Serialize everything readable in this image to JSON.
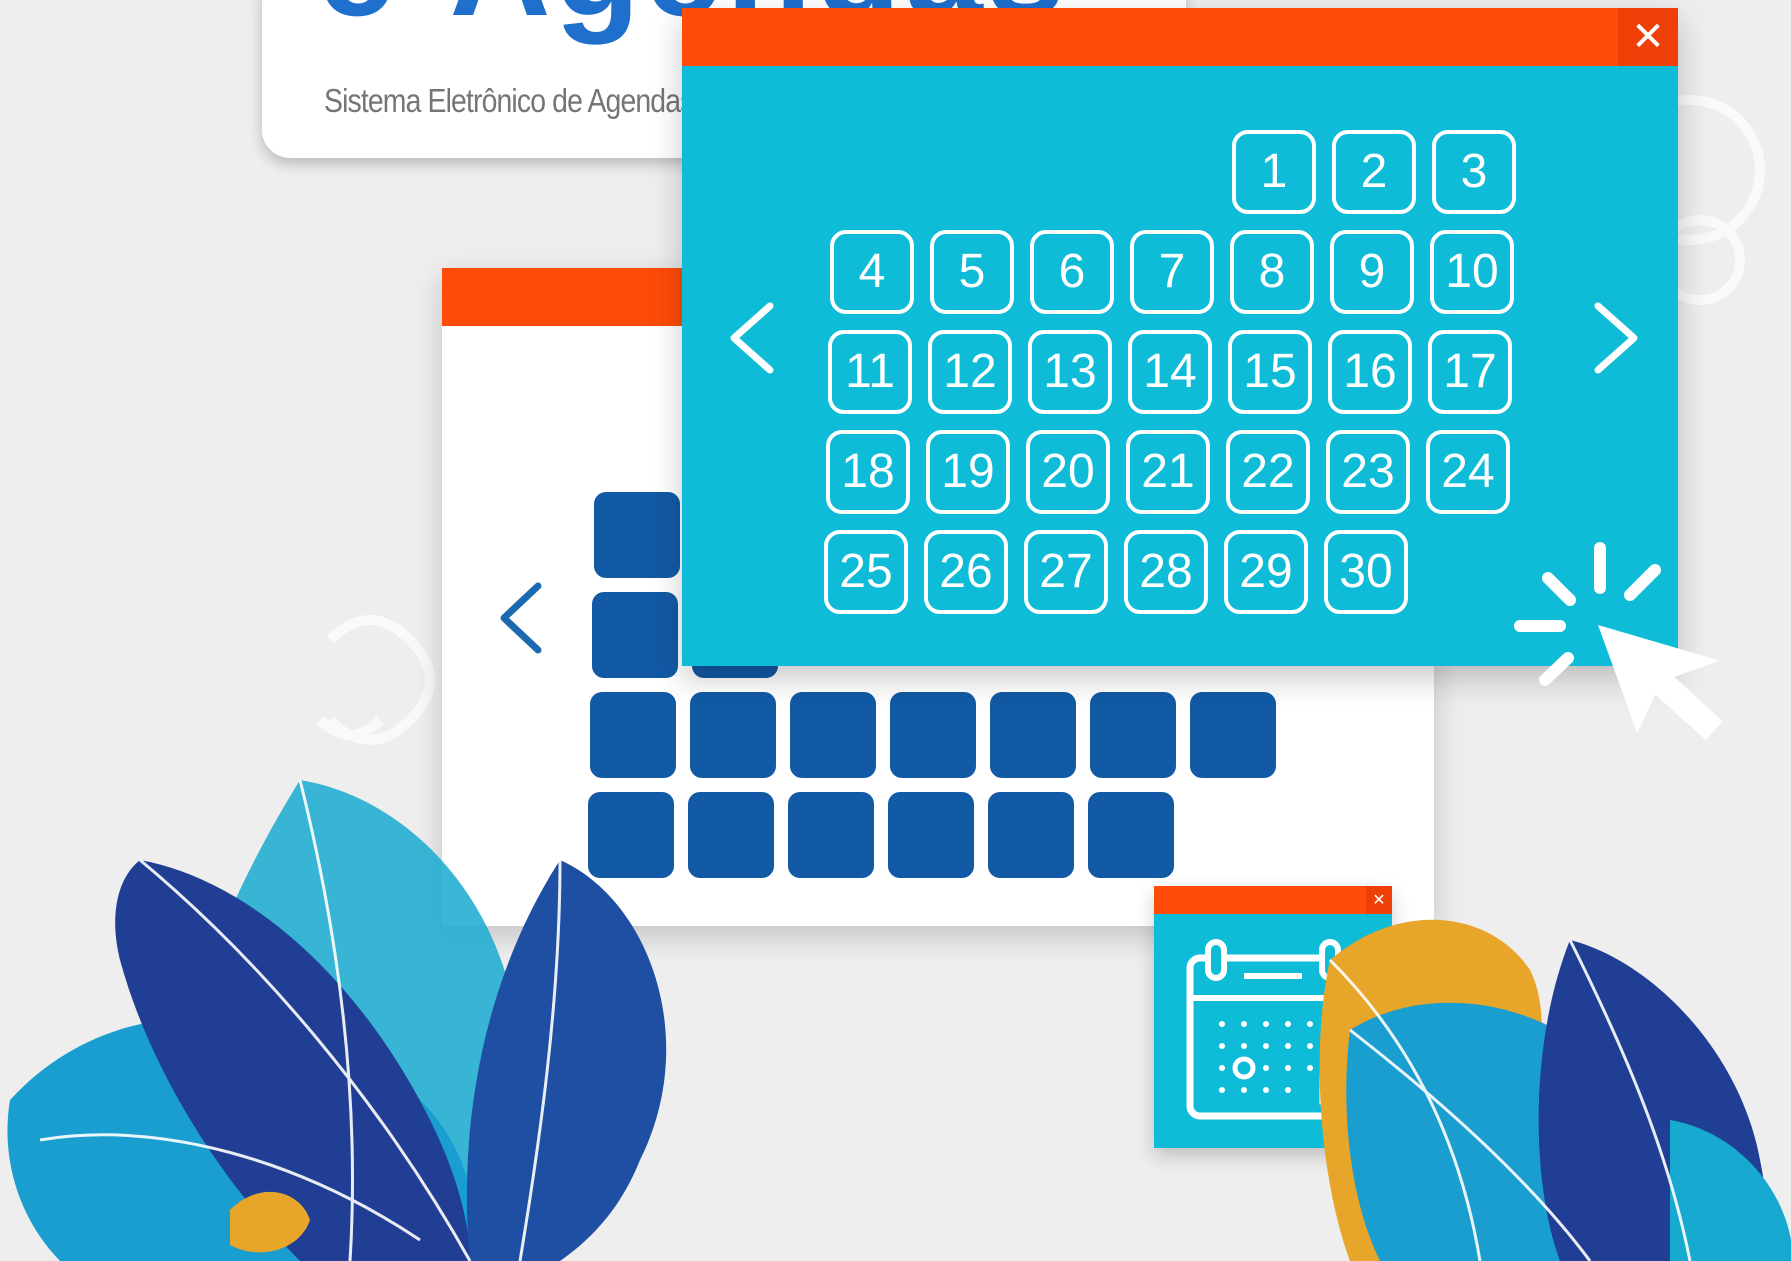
{
  "logo": {
    "title": "e-Agendas",
    "subtitle": "Sistema Eletrônico de Agendas do Poder Executivo Federal"
  },
  "front_window": {
    "close_label": "✕",
    "days": [
      "1",
      "2",
      "3",
      "4",
      "5",
      "6",
      "7",
      "8",
      "9",
      "10",
      "11",
      "12",
      "13",
      "14",
      "15",
      "16",
      "17",
      "18",
      "19",
      "20",
      "21",
      "22",
      "23",
      "24",
      "25",
      "26",
      "27",
      "28",
      "29",
      "30"
    ]
  },
  "back_window": {
    "prev_label": "‹"
  },
  "mini_window": {
    "close_label": "✕"
  },
  "icons": [
    "chevron-left-icon",
    "chevron-right-icon",
    "close-icon",
    "calendar-icon",
    "cursor-click-icon"
  ],
  "colors": {
    "accent_orange": "#fe4b08",
    "cyan": "#0fbcd7",
    "blue": "#125aa5",
    "logo_blue": "#1f6fcd"
  }
}
